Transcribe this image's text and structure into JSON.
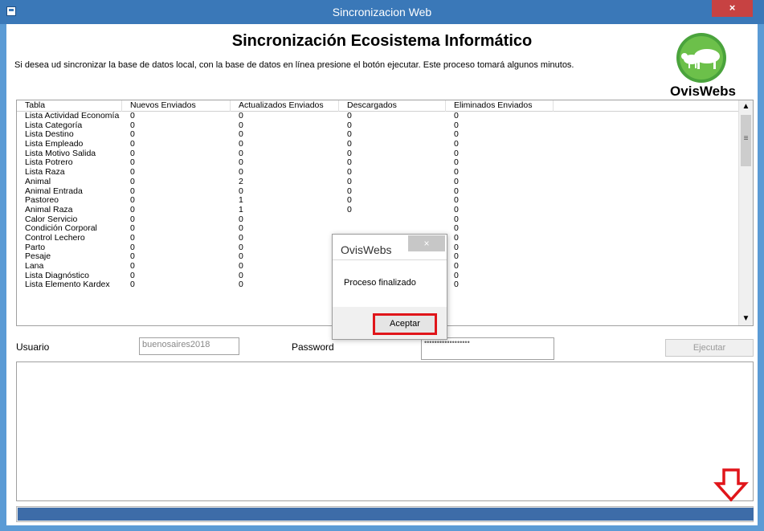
{
  "window": {
    "title": "Sincronizacion Web",
    "close_glyph": "×",
    "icon": "app-window-icon"
  },
  "header": {
    "heading": "Sincronización Ecosistema Informático",
    "subtitle": "Si desea ud sincronizar la base de datos local, con la base de datos en línea presione el botón ejecutar. Este proceso tomará algunos minutos.",
    "logo_text": "OvisWebs"
  },
  "grid": {
    "columns": [
      "Tabla",
      "Nuevos Enviados",
      "Actualizados Enviados",
      "Descargados",
      "Eliminados Enviados"
    ],
    "rows": [
      [
        "Lista Actividad Economía",
        "0",
        "0",
        "0",
        "0"
      ],
      [
        "Lista Categoría",
        "0",
        "0",
        "0",
        "0"
      ],
      [
        "Lista Destino",
        "0",
        "0",
        "0",
        "0"
      ],
      [
        "Lista Empleado",
        "0",
        "0",
        "0",
        "0"
      ],
      [
        "Lista Motivo Salida",
        "0",
        "0",
        "0",
        "0"
      ],
      [
        "Lista Potrero",
        "0",
        "0",
        "0",
        "0"
      ],
      [
        "Lista Raza",
        "0",
        "0",
        "0",
        "0"
      ],
      [
        "Animal",
        "0",
        "2",
        "0",
        "0"
      ],
      [
        "Animal Entrada",
        "0",
        "0",
        "0",
        "0"
      ],
      [
        "Pastoreo",
        "0",
        "1",
        "0",
        "0"
      ],
      [
        "Animal Raza",
        "0",
        "1",
        "0",
        "0"
      ],
      [
        "Calor Servicio",
        "0",
        "0",
        "",
        "0"
      ],
      [
        "Condición Corporal",
        "0",
        "0",
        "",
        "0"
      ],
      [
        "Control Lechero",
        "0",
        "0",
        "",
        "0"
      ],
      [
        "Parto",
        "0",
        "0",
        "",
        "0"
      ],
      [
        "Pesaje",
        "0",
        "0",
        "",
        "0"
      ],
      [
        "Lana",
        "0",
        "0",
        "",
        "0"
      ],
      [
        "Lista Diagnóstico",
        "0",
        "0",
        "",
        "0"
      ],
      [
        "Lista Elemento Kardex",
        "0",
        "0",
        "",
        "0"
      ]
    ],
    "scroll_up": "▲",
    "scroll_down": "▼",
    "grip": "≡"
  },
  "form": {
    "usuario_label": "Usuario",
    "usuario_value": "buenosaires2018",
    "password_label": "Password",
    "password_value": "••••••••••••••••••",
    "ejecutar_label": "Ejecutar"
  },
  "progress": {
    "fraction": 1.0
  },
  "dialog": {
    "title": "OvisWebs",
    "message": "Proceso finalizado",
    "button_label": "Aceptar",
    "close_glyph": "×"
  },
  "colors": {
    "titlebar": "#3a78b8",
    "progress_fill": "#3d6ca8",
    "highlight": "#e0151a",
    "arrow": "#e0151a"
  }
}
